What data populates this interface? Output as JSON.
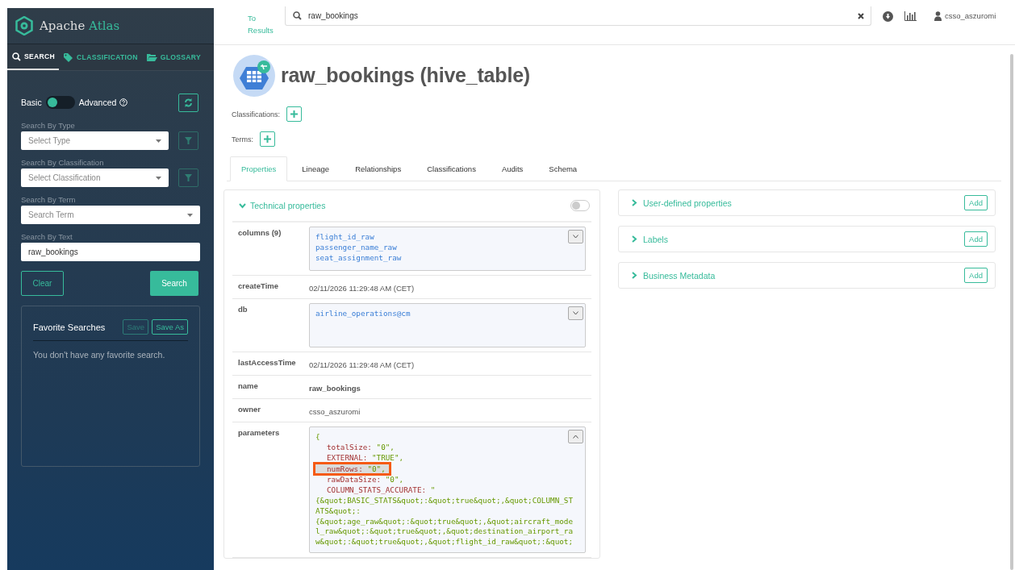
{
  "app": {
    "name_plain": "Apache",
    "name_accent": "Atlas"
  },
  "sidebar": {
    "tabs": [
      {
        "label": "SEARCH",
        "selected": true
      },
      {
        "label": "CLASSIFICATION",
        "selected": false
      },
      {
        "label": "GLOSSARY",
        "selected": false
      }
    ],
    "mode": {
      "basic_label": "Basic",
      "advanced_label": "Advanced",
      "advanced": false
    },
    "fields": [
      {
        "label": "Search By Type",
        "kind": "select",
        "placeholder": "Select Type",
        "filter": true
      },
      {
        "label": "Search By Classification",
        "kind": "select",
        "placeholder": "Select Classification",
        "filter": true
      },
      {
        "label": "Search By Term",
        "kind": "select",
        "placeholder": "Search Term",
        "filter": false
      },
      {
        "label": "Search By Text",
        "kind": "text",
        "value": "raw_bookings",
        "filter": false
      }
    ],
    "clear_button": "Clear",
    "search_button": "Search",
    "favorites": {
      "title": "Favorite Searches",
      "buttons": [
        {
          "label": "Save",
          "disabled": true
        },
        {
          "label": "Save As",
          "disabled": false
        }
      ],
      "empty_message": "You don't have any favorite search."
    }
  },
  "header": {
    "back_link": "To Results",
    "search_value": "raw_bookings",
    "user": "csso_aszuromi"
  },
  "entity": {
    "title": "raw_bookings (hive_table)",
    "classifications_label": "Classifications:",
    "terms_label": "Terms:"
  },
  "tabs": [
    {
      "label": "Properties",
      "selected": true
    },
    {
      "label": "Lineage",
      "selected": false
    },
    {
      "label": "Relationships",
      "selected": false
    },
    {
      "label": "Classifications",
      "selected": false
    },
    {
      "label": "Audits",
      "selected": false
    },
    {
      "label": "Schema",
      "selected": false
    }
  ],
  "technical": {
    "title": "Technical properties",
    "expanded": true,
    "toggle_on": false,
    "properties": [
      {
        "key": "columns (9)",
        "kind": "listbox",
        "expanded": false,
        "items": [
          "flight_id_raw",
          "passenger_name_raw",
          "seat_assignment_raw"
        ]
      },
      {
        "key": "createTime",
        "kind": "text",
        "value": "02/11/2026 11:29:48 AM (CET)"
      },
      {
        "key": "db",
        "kind": "listbox",
        "expanded": false,
        "items": [
          "airline_operations@cm"
        ]
      },
      {
        "key": "lastAccessTime",
        "kind": "text",
        "value": "02/11/2026 11:29:48 AM (CET)"
      },
      {
        "key": "name",
        "kind": "strong",
        "value": "raw_bookings"
      },
      {
        "key": "owner",
        "kind": "text",
        "value": "csso_aszuromi"
      },
      {
        "key": "parameters",
        "kind": "json",
        "expanded": true,
        "lines": [
          {
            "kind": "brace",
            "text": "{"
          },
          {
            "kind": "pair",
            "key": "totalSize:",
            "value": "\"0\",",
            "highlighted": false
          },
          {
            "kind": "pair",
            "key": "EXTERNAL:",
            "value": "\"TRUE\",",
            "highlighted": false
          },
          {
            "kind": "pair",
            "key": "numRows:",
            "value": "\"0\",",
            "highlighted": true
          },
          {
            "kind": "pair",
            "key": "rawDataSize:",
            "value": "\"0\",",
            "highlighted": false
          },
          {
            "kind": "pair",
            "key": "COLUMN_STATS_ACCURATE:",
            "value": "\"",
            "highlighted": false
          },
          {
            "kind": "raw",
            "text": "{&quot;BASIC_STATS&quot;:&quot;true&quot;,&quot;COLUMN_ST"
          },
          {
            "kind": "raw",
            "text": "ATS&quot;:"
          },
          {
            "kind": "raw",
            "text": "{&quot;age_raw&quot;:&quot;true&quot;,&quot;aircraft_mode"
          },
          {
            "kind": "raw",
            "text": "l_raw&quot;:&quot;true&quot;,&quot;destination_airport_ra"
          },
          {
            "kind": "raw",
            "text": "w&quot;:&quot;true&quot;,&quot;flight_id_raw&quot;:&quot;"
          }
        ]
      }
    ]
  },
  "side_panels": [
    {
      "title": "User-defined properties",
      "button": "Add"
    },
    {
      "title": "Labels",
      "button": "Add"
    },
    {
      "title": "Business Metadata",
      "button": "Add"
    }
  ]
}
